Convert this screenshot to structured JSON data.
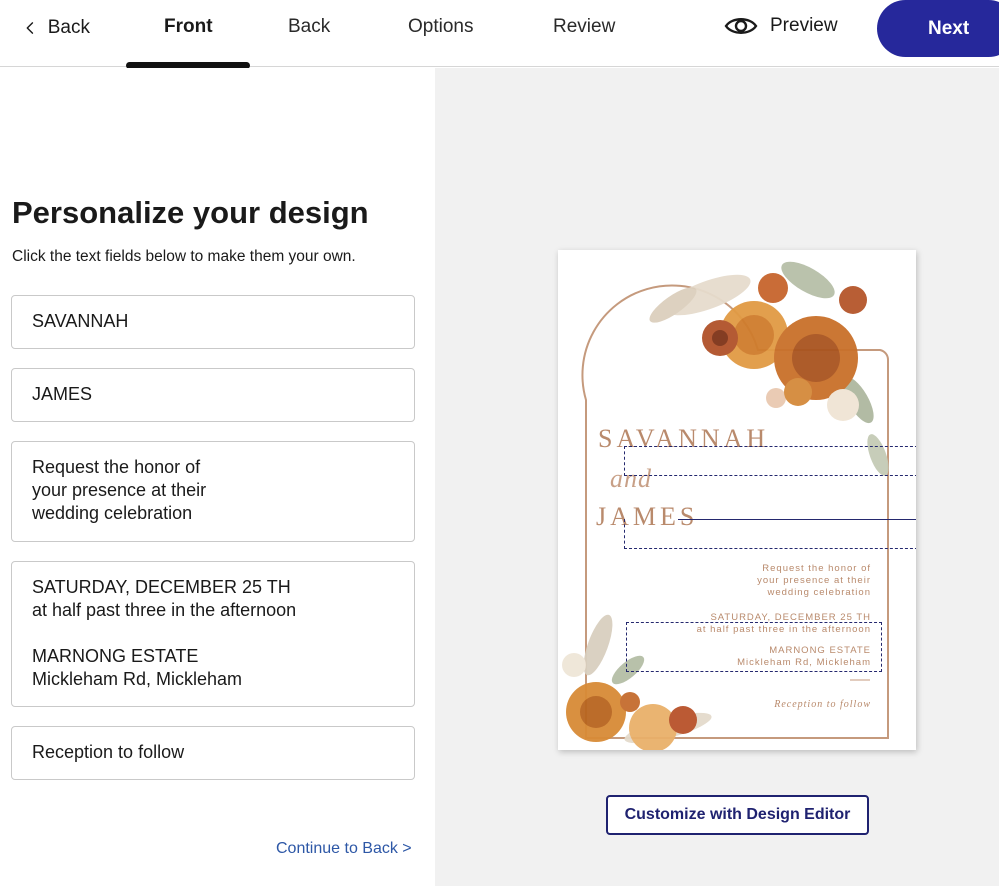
{
  "nav": {
    "back_label": "Back",
    "tabs": [
      "Front",
      "Back",
      "Options",
      "Review"
    ],
    "active_tab": "Front",
    "preview_label": "Preview",
    "next_label": "Next",
    "accent_color": "#26289b"
  },
  "editor": {
    "title": "Personalize your design",
    "subtitle": "Click the text fields below to make them your own.",
    "fields": [
      "SAVANNAH",
      "JAMES",
      "Request the honor of\nyour presence at their\nwedding celebration",
      "SATURDAY, DECEMBER 25 TH\nat half past three in the afternoon\n\nMARNONG ESTATE\nMickleham Rd, Mickleham",
      "Reception to follow"
    ],
    "continue_label": "Continue to Back >"
  },
  "preview": {
    "card": {
      "name1": "SAVANNAH",
      "and_script": "and",
      "name2": "JAMES",
      "request": "Request the honor of\nyour presence at their\nwedding celebration",
      "date": "SATURDAY, DECEMBER 25 TH\nat half past three in the afternoon",
      "venue": "MARNONG ESTATE\nMickleham Rd, Mickleham",
      "reception": "Reception to follow"
    },
    "customize_label": "Customize with Design Editor"
  }
}
